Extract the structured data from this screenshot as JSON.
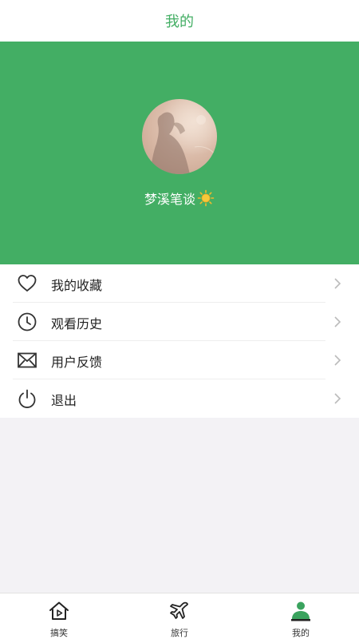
{
  "header": {
    "title": "我的"
  },
  "profile": {
    "username": "梦溪笔谈",
    "emoji_icon": "sun-icon",
    "avatar_icon": "avatar-photo"
  },
  "menu": {
    "items": [
      {
        "label": "我的收藏",
        "icon": "heart-icon"
      },
      {
        "label": "观看历史",
        "icon": "clock-icon"
      },
      {
        "label": "用户反馈",
        "icon": "envelope-icon"
      },
      {
        "label": "退出",
        "icon": "power-icon"
      }
    ]
  },
  "tabbar": {
    "tabs": [
      {
        "label": "搞笑",
        "icon": "home-play-icon"
      },
      {
        "label": "旅行",
        "icon": "airplane-icon"
      },
      {
        "label": "我的",
        "icon": "user-icon",
        "active": true
      }
    ]
  },
  "colors": {
    "accent": "#43ae64",
    "background": "#f3f2f5",
    "text": "#222222"
  }
}
